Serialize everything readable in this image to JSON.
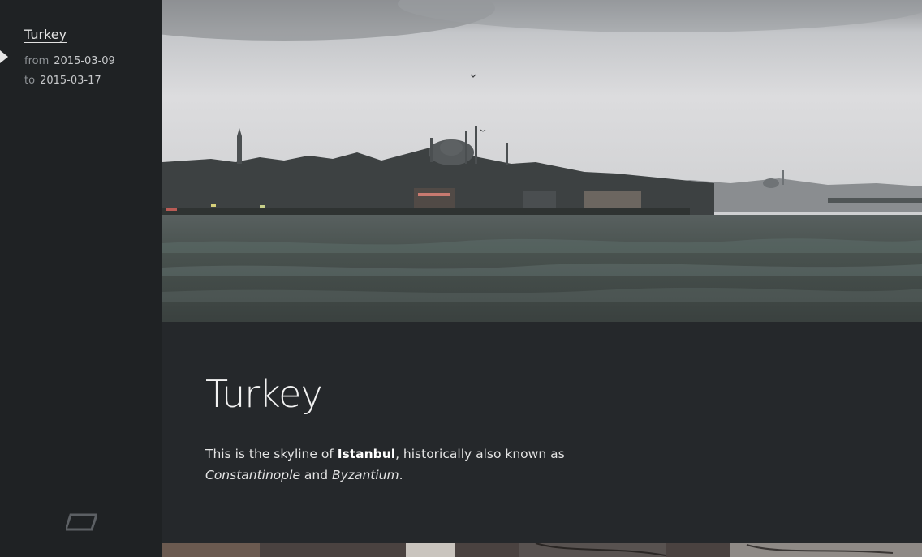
{
  "sidebar": {
    "trip": {
      "title": "Turkey",
      "from_label": "from",
      "from_date": "2015-03-09",
      "to_label": "to",
      "to_date": "2015-03-17"
    },
    "bottom_icon": "parallelogram-icon"
  },
  "main": {
    "hero_image": "istanbul-skyline-photo",
    "title": "Turkey",
    "description": {
      "part1": "This is the skyline of ",
      "bold": "Istanbul",
      "part2": ", historically also known as ",
      "italic1": "Constantinople",
      "part3": " and ",
      "italic2": "Byzantium",
      "part4": "."
    }
  },
  "colors": {
    "sidebar_bg": "#1f2224",
    "content_bg": "#25282b",
    "accent_text": "#e2e2e2"
  }
}
